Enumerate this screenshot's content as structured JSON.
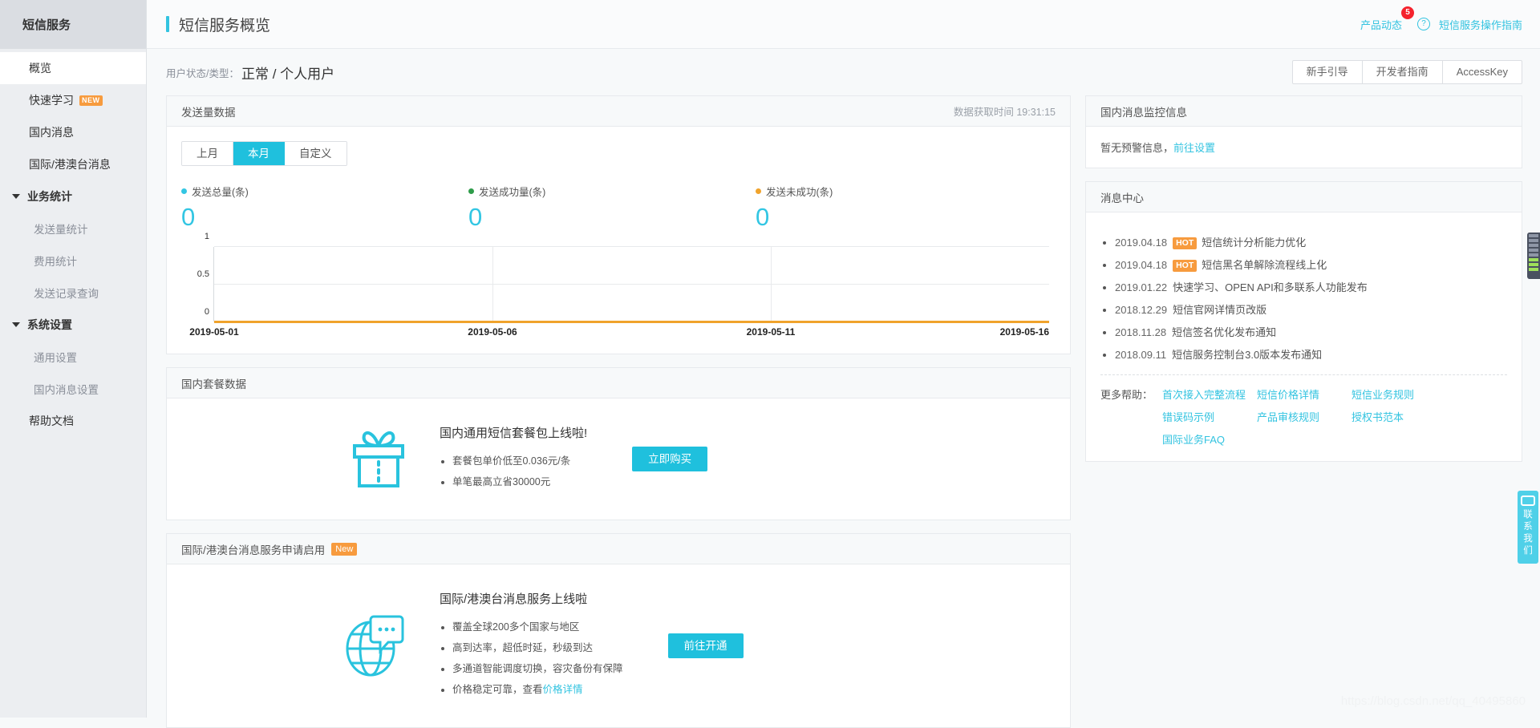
{
  "sidebar": {
    "brand": "短信服务",
    "items": [
      {
        "label": "概览",
        "type": "item",
        "active": true
      },
      {
        "label": "快速学习",
        "type": "item",
        "badge": "NEW"
      },
      {
        "label": "国内消息",
        "type": "item"
      },
      {
        "label": "国际/港澳台消息",
        "type": "item"
      },
      {
        "label": "业务统计",
        "type": "group"
      },
      {
        "label": "发送量统计",
        "type": "sub"
      },
      {
        "label": "费用统计",
        "type": "sub"
      },
      {
        "label": "发送记录查询",
        "type": "sub"
      },
      {
        "label": "系统设置",
        "type": "group"
      },
      {
        "label": "通用设置",
        "type": "sub"
      },
      {
        "label": "国内消息设置",
        "type": "sub"
      },
      {
        "label": "帮助文档",
        "type": "item"
      }
    ]
  },
  "header": {
    "title": "短信服务概览",
    "product_news": "产品动态",
    "product_news_count": "5",
    "help_icon": "?",
    "guide_link": "短信服务操作指南"
  },
  "status": {
    "label": "用户状态/类型：",
    "value": "正常 / 个人用户",
    "buttons": [
      "新手引导",
      "开发者指南",
      "AccessKey"
    ]
  },
  "send_card": {
    "title": "发送量数据",
    "fetch_label": "数据获取时间",
    "fetch_time": "19:31:15",
    "tabs": [
      {
        "label": "上月",
        "active": false
      },
      {
        "label": "本月",
        "active": true
      },
      {
        "label": "自定义",
        "active": false
      }
    ],
    "kpis": [
      {
        "label": "发送总量(条)",
        "value": "0",
        "color": "#33c6e3"
      },
      {
        "label": "发送成功量(条)",
        "value": "0",
        "color": "#2e9c4a"
      },
      {
        "label": "发送未成功(条)",
        "value": "0",
        "color": "#f0a32c"
      }
    ]
  },
  "chart_data": {
    "type": "line",
    "title": "发送量数据",
    "xlabel": "",
    "ylabel": "",
    "ylim": [
      0,
      1
    ],
    "yticks": [
      "0",
      "0.5",
      "1"
    ],
    "xticks": [
      "2019-05-01",
      "2019-05-06",
      "2019-05-11",
      "2019-05-16"
    ],
    "grid": true,
    "legend_position": "top",
    "x": [
      "2019-05-01",
      "2019-05-06",
      "2019-05-11",
      "2019-05-16"
    ],
    "series": [
      {
        "name": "发送总量(条)",
        "color": "#33c6e3",
        "values": [
          0,
          0,
          0,
          0
        ]
      },
      {
        "name": "发送成功量(条)",
        "color": "#2e9c4a",
        "values": [
          0,
          0,
          0,
          0
        ]
      },
      {
        "name": "发送未成功(条)",
        "color": "#f0a32c",
        "values": [
          0,
          0,
          0,
          0
        ]
      }
    ]
  },
  "package_card": {
    "title": "国内套餐数据",
    "heading": "国内通用短信套餐包上线啦!",
    "bullets": [
      "套餐包单价低至0.036元/条",
      "单笔最高立省30000元"
    ],
    "button": "立即购买"
  },
  "intl_card": {
    "title": "国际/港澳台消息服务申请启用",
    "badge": "New",
    "heading": "国际/港澳台消息服务上线啦",
    "bullets": [
      "覆盖全球200多个国家与地区",
      "高到达率，超低时延，秒级到达",
      "多通道智能调度切换，容灾备份有保障"
    ],
    "last_bullet_prefix": "价格稳定可靠，查看",
    "last_bullet_link": "价格详情",
    "button": "前往开通"
  },
  "monitor_card": {
    "title": "国内消息监控信息",
    "text": "暂无预警信息，",
    "link": "前往设置"
  },
  "message_center": {
    "title": "消息中心",
    "items": [
      {
        "date": "2019.04.18",
        "tag": "HOT",
        "text": "短信统计分析能力优化"
      },
      {
        "date": "2019.04.18",
        "tag": "HOT",
        "text": "短信黑名单解除流程线上化"
      },
      {
        "date": "2019.01.22",
        "tag": "",
        "text": "快速学习、OPEN API和多联系人功能发布"
      },
      {
        "date": "2018.12.29",
        "tag": "",
        "text": "短信官网详情页改版"
      },
      {
        "date": "2018.11.28",
        "tag": "",
        "text": "短信签名优化发布通知"
      },
      {
        "date": "2018.09.11",
        "tag": "",
        "text": "短信服务控制台3.0版本发布通知"
      }
    ],
    "help_label": "更多帮助：",
    "help_links": [
      "首次接入完整流程",
      "短信价格详情",
      "短信业务规则",
      "错误码示例",
      "产品审核规则",
      "授权书范本",
      "国际业务FAQ"
    ]
  },
  "floating": {
    "contact_label": "联系我们",
    "contact_chars": [
      "联",
      "系",
      "我",
      "们"
    ]
  },
  "watermark": "https://blog.csdn.net/qq_40495860",
  "colors": {
    "accent": "#1fc0dd",
    "orange": "#f79b3e",
    "red": "#f5222d",
    "green": "#2e9c4a"
  }
}
